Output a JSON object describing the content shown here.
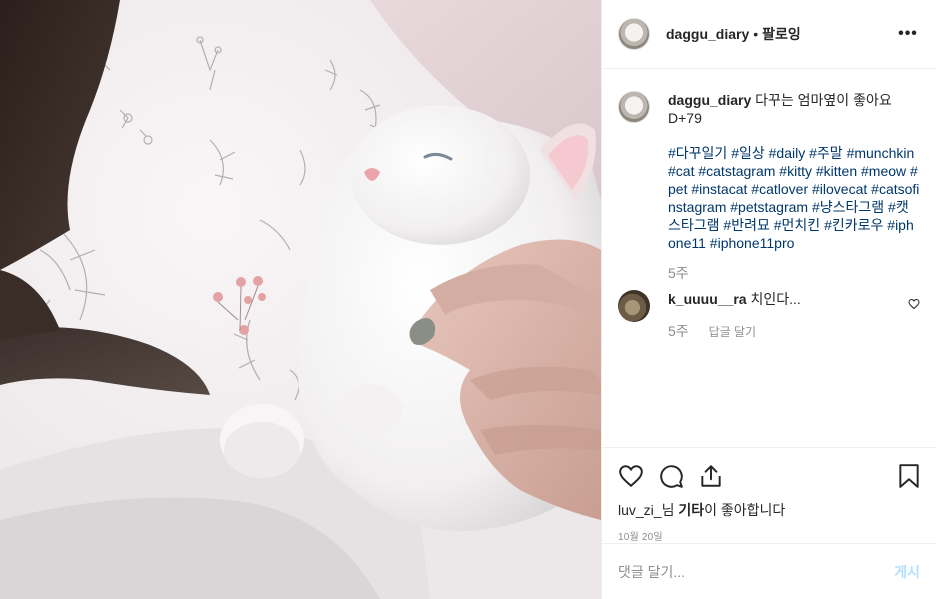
{
  "header": {
    "username": "daggu_diary",
    "separator": "•",
    "follow": "팔로잉",
    "more": "•••"
  },
  "caption": {
    "username": "daggu_diary",
    "text": "다꾸는 엄마옆이 좋아요",
    "line2": "D+79",
    "hashtags": [
      "#다꾸일기",
      "#일상",
      "#daily",
      "#주말",
      "#munchkin",
      "#cat",
      "#catstagram",
      "#kitty",
      "#kitten",
      "#meow",
      "#pet",
      "#instacat",
      "#catlover",
      "#ilovecat",
      "#catsofinstagram",
      "#petstagram",
      "#냥스타그램",
      "#캣스타그램",
      "#반려묘",
      "#먼치킨",
      "#킨카로우",
      "#iphone11",
      "#iphone11pro"
    ],
    "time": "5주"
  },
  "comment": {
    "username": "k_uuuu__ra",
    "text": "치인다...",
    "time": "5주",
    "reply": "답글 달기"
  },
  "icons": {
    "like": "heart-icon",
    "comment": "comment-icon",
    "share": "share-icon",
    "save": "bookmark-icon"
  },
  "likes": {
    "user": "luv_zi_",
    "mid": "님 ",
    "others": "기타",
    "suffix": "이 좋아합니다"
  },
  "date": "10월 20일",
  "add_comment": {
    "placeholder": "댓글 달기...",
    "post": "게시"
  }
}
